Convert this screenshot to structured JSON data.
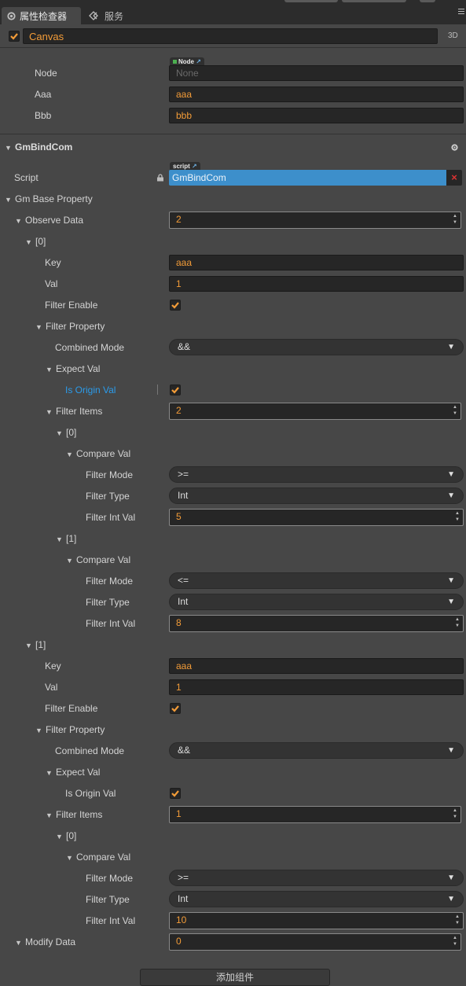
{
  "tabs": [
    {
      "label": "属性检查器",
      "icon": "gear-icon"
    },
    {
      "label": "服务",
      "icon": "service-icon"
    }
  ],
  "node": {
    "name": "Canvas",
    "badge_3d": "3D"
  },
  "top_props": [
    {
      "label": "Node",
      "value": "None",
      "badge": "Node"
    },
    {
      "label": "Aaa",
      "value": "aaa"
    },
    {
      "label": "Bbb",
      "value": "bbb"
    }
  ],
  "component": {
    "title": "GmBindCom",
    "script_label": "Script",
    "script_value": "GmBindCom",
    "script_badge": "script"
  },
  "labels": {
    "gm_base_property": "Gm Base Property",
    "observe_data": "Observe Data",
    "idx0": "[0]",
    "idx1": "[1]",
    "key": "Key",
    "val": "Val",
    "filter_enable": "Filter Enable",
    "filter_property": "Filter Property",
    "combined_mode": "Combined Mode",
    "expect_val": "Expect Val",
    "is_origin_val": "Is Origin Val",
    "filter_items": "Filter Items",
    "compare_val": "Compare Val",
    "filter_mode": "Filter Mode",
    "filter_type": "Filter Type",
    "filter_int_val": "Filter Int Val",
    "modify_data": "Modify Data"
  },
  "values": {
    "observe_count": "2",
    "item0": {
      "key": "aaa",
      "val": "1",
      "combined_mode": "&&",
      "filter_items_count": "2",
      "filters": [
        {
          "mode": ">=",
          "type": "Int",
          "int_val": "5"
        },
        {
          "mode": "<=",
          "type": "Int",
          "int_val": "8"
        }
      ]
    },
    "item1": {
      "key": "aaa",
      "val": "1",
      "combined_mode": "&&",
      "filter_items_count": "1",
      "filters": [
        {
          "mode": ">=",
          "type": "Int",
          "int_val": "10"
        }
      ]
    },
    "modify_count": "0"
  },
  "add_component_button": "添加组件",
  "colors": {
    "accent": "#f39c38",
    "highlight": "#2b9bea",
    "script_bg": "#3d8fcb",
    "panel_bg": "#474747"
  }
}
